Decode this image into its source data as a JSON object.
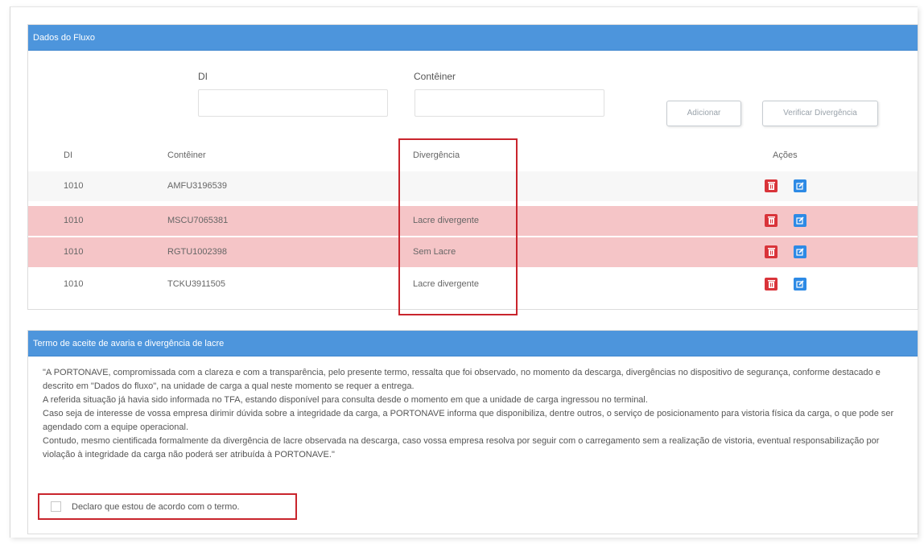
{
  "fluxo": {
    "header": "Dados do Fluxo",
    "di_label": "DI",
    "di_value": "",
    "container_label": "Contêiner",
    "container_value": "",
    "add_button": "Adicionar",
    "verify_button": "Verificar Divergência",
    "table": {
      "headers": {
        "di": "DI",
        "container": "Contêiner",
        "divergence": "Divergência",
        "actions": "Ações"
      },
      "rows": [
        {
          "di": "1010",
          "container": "AMFU3196539",
          "divergence": "",
          "status": "normal"
        },
        {
          "di": "1010",
          "container": "MSCU7065381",
          "divergence": "Lacre divergente",
          "status": "divergent"
        },
        {
          "di": "1010",
          "container": "RGTU1002398",
          "divergence": "Sem Lacre",
          "status": "divergent"
        },
        {
          "di": "1010",
          "container": "TCKU3911505",
          "divergence": "Lacre divergente",
          "status": "normal"
        }
      ]
    },
    "icons": {
      "delete": "trash-icon",
      "edit": "edit-icon"
    }
  },
  "termo": {
    "header": "Termo de aceite de avaria e divergência de lacre",
    "paragraphs": [
      "\"A PORTONAVE, compromissada com a clareza e com a transparência, pelo presente termo, ressalta que foi observado, no momento da descarga, divergências no dispositivo de segurança, conforme destacado e descrito em \"Dados do fluxo\", na unidade de carga a qual neste momento se requer a entrega.",
      "A referida situação já havia sido informada no TFA, estando disponível para consulta desde o momento em que a unidade de carga ingressou no terminal.",
      "Caso seja de interesse de vossa empresa dirimir dúvida sobre a integridade da carga, a PORTONAVE informa que disponibiliza, dentre outros, o serviço de posicionamento para vistoria física da carga, o que pode ser agendado com a equipe operacional.",
      "Contudo, mesmo cientificada formalmente da divergência de lacre observada na descarga, caso vossa empresa resolva por seguir com o carregamento sem a realização de vistoria, eventual responsabilização por violação à integridade da carga não poderá ser atribuída à PORTONAVE.\""
    ],
    "checkbox_label": "Declaro que estou de acordo com o termo.",
    "checkbox_checked": false
  },
  "colors": {
    "header_blue": "#4d95dc",
    "row_divergent": "#f5c5c7",
    "highlight_red": "#c9252d",
    "delete_red": "#d9343a",
    "edit_blue": "#2d8ae5"
  }
}
